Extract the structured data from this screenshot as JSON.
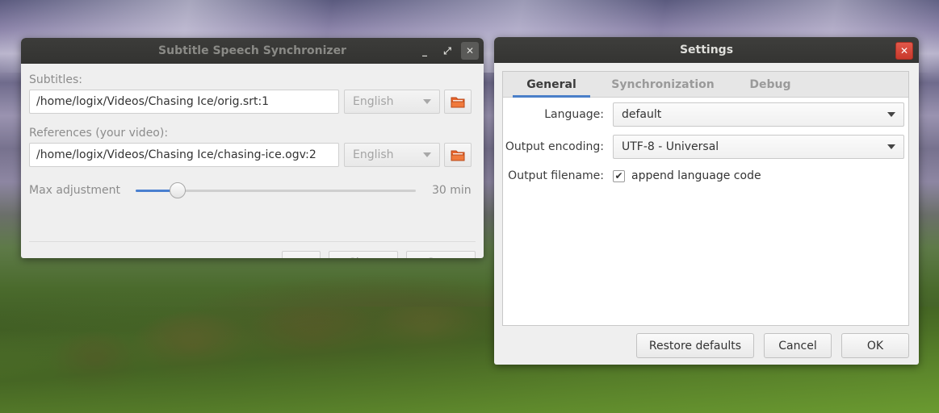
{
  "sync_window": {
    "title": "Subtitle Speech Synchronizer",
    "controls": {
      "minimize": "_",
      "maximize": "⤢",
      "close": "✕"
    },
    "subtitles": {
      "label": "Subtitles:",
      "path": "/home/logix/Videos/Chasing Ice/orig.srt:1",
      "language": "English"
    },
    "references": {
      "label": "References (your video):",
      "path": "/home/logix/Videos/Chasing Ice/chasing-ice.ogv:2",
      "language": "English"
    },
    "max_adjustment": {
      "label": "Max adjustment",
      "value_text": "30 min",
      "fraction": 0.15
    },
    "buttons": {
      "menu": "⋮",
      "close": "Close",
      "start": "Start"
    }
  },
  "settings_window": {
    "title": "Settings",
    "close": "✕",
    "tabs": [
      {
        "label": "General",
        "active": true
      },
      {
        "label": "Synchronization",
        "active": false
      },
      {
        "label": "Debug",
        "active": false
      }
    ],
    "language": {
      "label": "Language:",
      "value": "default"
    },
    "output_encoding": {
      "label": "Output encoding:",
      "value": "UTF-8 - Universal"
    },
    "output_filename": {
      "label": "Output filename:",
      "checkbox_label": "append language code",
      "checked": true,
      "check_mark": "✔"
    },
    "buttons": {
      "restore": "Restore defaults",
      "cancel": "Cancel",
      "ok": "OK"
    }
  },
  "colors": {
    "accent": "#4a80d0",
    "close_red": "#d64a3c",
    "titlebar": "#383836",
    "folder_icon": "#e8642c"
  }
}
